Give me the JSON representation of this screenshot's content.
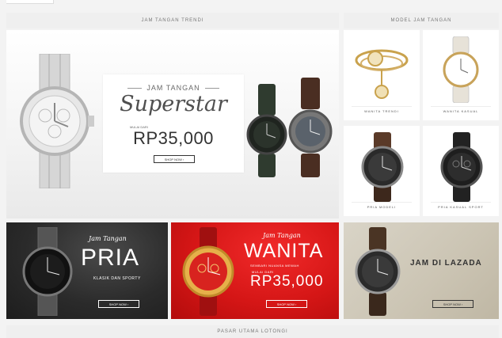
{
  "sections": {
    "left_header": "JAM TANGAN TRENDI",
    "right_header": "MODEL JAM TANGAN",
    "footer_header": "PASAR UTAMA LOTONGI"
  },
  "hero": {
    "kicker": "JAM TANGAN",
    "title": "Superstar",
    "price_prefix": "MULAI DARI",
    "price": "RP35,000",
    "button": "SHOP NOW ›"
  },
  "models": [
    {
      "label": "WANITA TRENDI"
    },
    {
      "label": "WANITA KASUAL"
    },
    {
      "label": "PRIA MODELI"
    },
    {
      "label": "PRIA KASUAL SPORT"
    }
  ],
  "banners": {
    "pria": {
      "kicker": "Jam Tangan",
      "title": "PRIA",
      "sub": "KLASIK DAN SPORTY",
      "button": "SHOP NOW ›"
    },
    "wanita": {
      "kicker": "Jam Tangan",
      "title": "WANITA",
      "sub": "SEMBARI NUANSA MEWAH",
      "price_prefix": "MULAI DARI",
      "price": "RP35,000",
      "button": "SHOP NOW ›"
    },
    "lazada": {
      "title": "JAM DI LAZADA",
      "button": "SHOP NOW ›"
    }
  },
  "colors": {
    "red": "#d51616",
    "dark": "#2b2b2b",
    "beige": "#cbc4b3"
  }
}
